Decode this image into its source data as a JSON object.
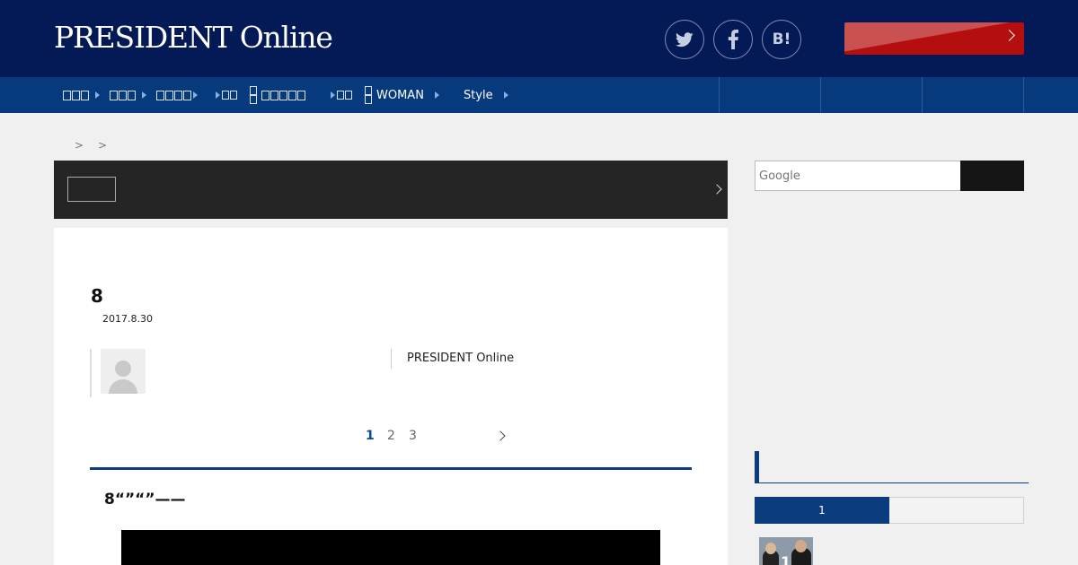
{
  "header": {
    "logo": "PRESIDENT Online",
    "social": {
      "twitter_icon": "twitter-bird-icon",
      "facebook_icon": "facebook-f-icon",
      "hatena_label": "B!"
    },
    "cta_label": ""
  },
  "nav": {
    "items": [
      {
        "label": "",
        "arrow": true
      },
      {
        "label": "",
        "arrow": true
      },
      {
        "label": "",
        "arrow": true
      },
      {
        "label": "",
        "arrow": false
      },
      {
        "label": "",
        "arrow": false
      },
      {
        "label": "",
        "arrow": false
      },
      {
        "label": "WOMAN",
        "arrow": true
      },
      {
        "label": "Style",
        "arrow": true
      }
    ]
  },
  "breadcrumb": {
    "separators": [
      ">",
      ">"
    ]
  },
  "article": {
    "headline": "8",
    "date": "2017.8.30",
    "source": "PRESIDENT Online",
    "pagination": {
      "pages": [
        "1",
        "2",
        "3"
      ],
      "current": "1"
    },
    "section_heading": "8“”“”——"
  },
  "sidebar": {
    "search_placeholder": "Google",
    "ranking_tab_label": "1",
    "first_rank": "1"
  },
  "colors": {
    "header_bg": "#031a57",
    "nav_bg": "#073a7c",
    "accent_red": "#b40e0e",
    "accent_blue": "#0b3d7e"
  }
}
